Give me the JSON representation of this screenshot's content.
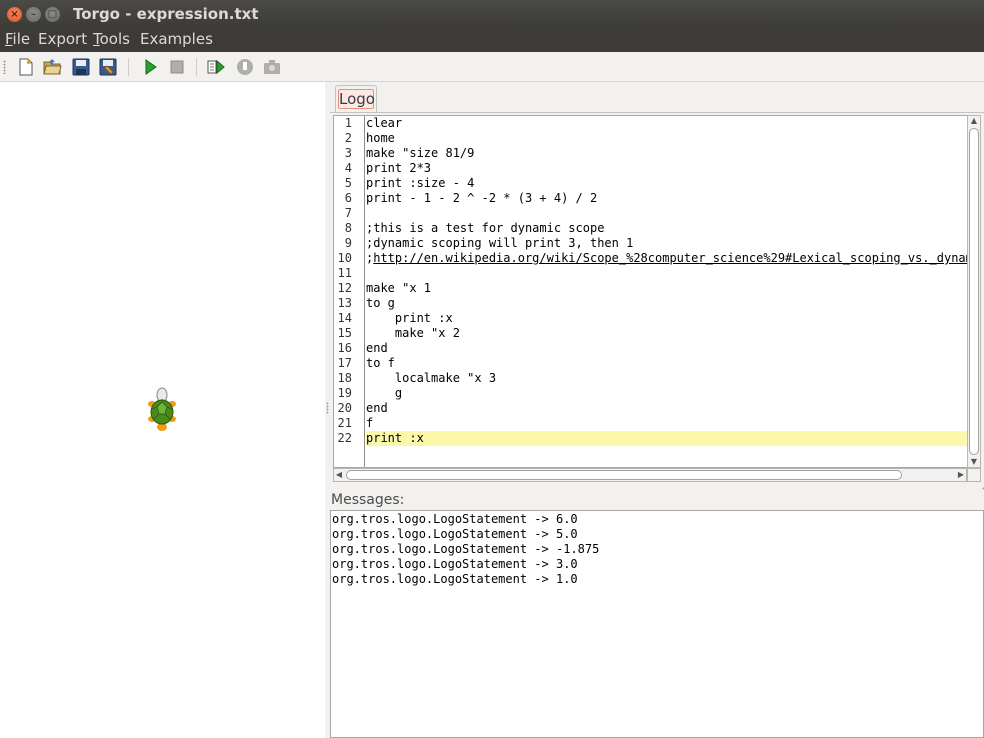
{
  "window": {
    "title": "Torgo - expression.txt",
    "close_glyph": "×",
    "min_glyph": "–",
    "max_glyph": "□"
  },
  "menu": {
    "file": {
      "mnemonic": "F",
      "rest": "ile"
    },
    "export": {
      "label": "Export"
    },
    "tools": {
      "mnemonic": "T",
      "rest": "ools"
    },
    "examples": {
      "label": "Examples"
    }
  },
  "toolbar": {
    "icons": [
      "new-file-icon",
      "open-folder-icon",
      "save-icon",
      "save-as-icon",
      "run-icon",
      "stop-icon",
      "step-icon",
      "pause-icon",
      "camera-icon"
    ]
  },
  "editor": {
    "tab_label": "Logo",
    "lines": [
      {
        "num": "1",
        "text": "clear"
      },
      {
        "num": "2",
        "text": "home"
      },
      {
        "num": "3",
        "text": "make \"size 81/9"
      },
      {
        "num": "4",
        "text": "print 2*3"
      },
      {
        "num": "5",
        "text": "print :size - 4"
      },
      {
        "num": "6",
        "text": "print - 1 - 2 ^ -2 * (3 + 4) / 2"
      },
      {
        "num": "7",
        "text": ""
      },
      {
        "num": "8",
        "text": ";this is a test for dynamic scope"
      },
      {
        "num": "9",
        "text": ";dynamic scoping will print 3, then 1"
      },
      {
        "num": "10",
        "text": ";",
        "link": "http://en.wikipedia.org/wiki/Scope_%28computer_science%29#Lexical_scoping_vs._dynamic_scoping"
      },
      {
        "num": "11",
        "text": ""
      },
      {
        "num": "12",
        "text": "make \"x 1"
      },
      {
        "num": "13",
        "text": "to g"
      },
      {
        "num": "14",
        "text": "    print :x"
      },
      {
        "num": "15",
        "text": "    make \"x 2"
      },
      {
        "num": "16",
        "text": "end"
      },
      {
        "num": "17",
        "text": "to f"
      },
      {
        "num": "18",
        "text": "    localmake \"x 3"
      },
      {
        "num": "19",
        "text": "    g"
      },
      {
        "num": "20",
        "text": "end"
      },
      {
        "num": "21",
        "text": "f"
      },
      {
        "num": "22",
        "text": "print :x"
      }
    ],
    "highlighted_line": 22,
    "highlight_color": "#fbf8a9"
  },
  "messages": {
    "label": "Messages:",
    "lines": [
      "org.tros.logo.LogoStatement -> 6.0",
      "org.tros.logo.LogoStatement -> 5.0",
      "org.tros.logo.LogoStatement -> -1.875",
      "org.tros.logo.LogoStatement -> 3.0",
      "org.tros.logo.LogoStatement -> 1.0"
    ]
  },
  "colors": {
    "titlebar": "#3c3b37",
    "accent": "#e0501e",
    "turtle_shell": "#4a8a1c"
  }
}
